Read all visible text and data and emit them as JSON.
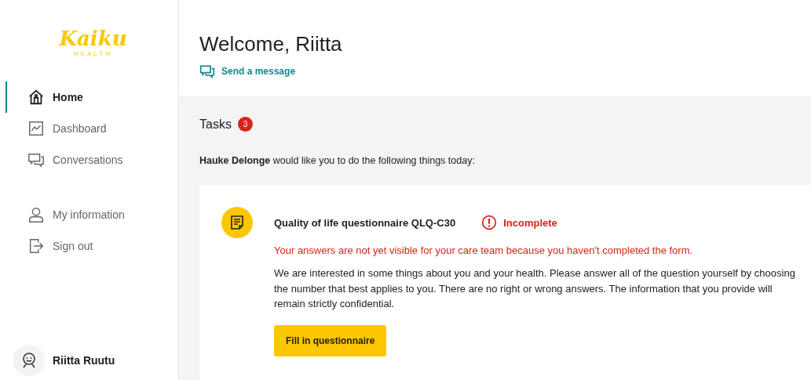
{
  "logo": {
    "name": "Kaiku",
    "tagline": "HEALTH"
  },
  "nav": [
    {
      "label": "Home",
      "kind": "home",
      "selected": true
    },
    {
      "label": "Dashboard",
      "kind": "dashboard",
      "selected": false
    },
    {
      "label": "Conversations",
      "kind": "conversations",
      "selected": false
    }
  ],
  "account_nav": [
    {
      "label": "My information",
      "kind": "person",
      "selected": false
    },
    {
      "label": "Sign out",
      "kind": "signout",
      "selected": false
    }
  ],
  "user": {
    "name": "Riitta Ruutu"
  },
  "header": {
    "title": "Welcome, Riitta",
    "send_message": "Send a message"
  },
  "tasks": {
    "title": "Tasks",
    "count": "3",
    "intro": "**Hauke Delonge** would like you to do the following things today:",
    "items": [
      {
        "title": "Quality of life questionnaire QLQ-C30",
        "status": "Incomplete",
        "warning": "Your answers are not yet visible for your care team because you haven't completed the form.",
        "description": "We are interested in some things about you and your health. Please answer all of the question yourself by choosing the number that best applies to you. There are no right or wrong answers. The information that you provide will remain strictly confidential.",
        "button": "Fill in questionnaire"
      }
    ]
  }
}
